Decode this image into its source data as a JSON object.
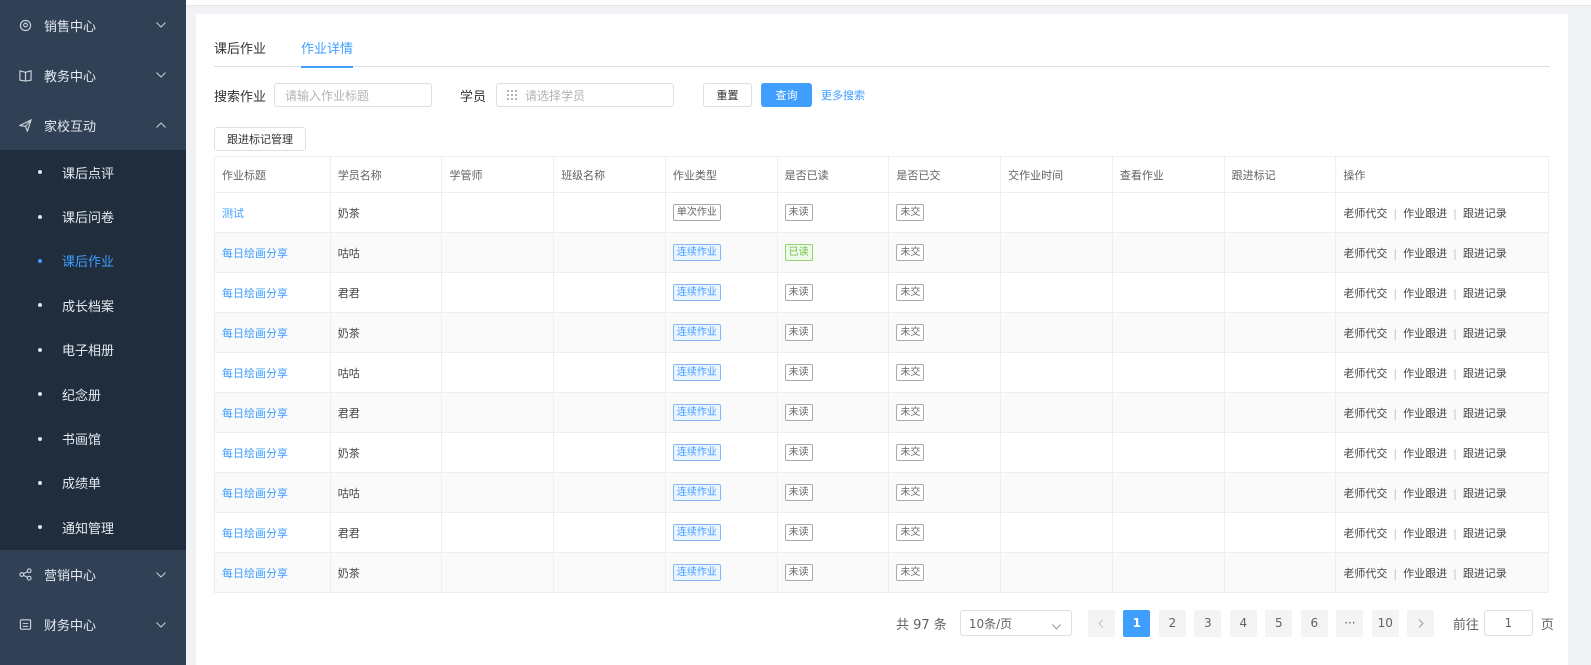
{
  "sidebar": {
    "groups_top": [
      {
        "label": "销售中心",
        "icon": "headset-icon"
      },
      {
        "label": "教务中心",
        "icon": "book-icon"
      },
      {
        "label": "家校互动",
        "icon": "paper-plane-icon"
      }
    ],
    "sub_items": [
      {
        "label": "课后点评"
      },
      {
        "label": "课后问卷"
      },
      {
        "label": "课后作业"
      },
      {
        "label": "成长档案"
      },
      {
        "label": "电子相册"
      },
      {
        "label": "纪念册"
      },
      {
        "label": "书画馆"
      },
      {
        "label": "成绩单"
      },
      {
        "label": "通知管理"
      }
    ],
    "groups_bottom": [
      {
        "label": "营销中心",
        "icon": "share-icon"
      },
      {
        "label": "财务中心",
        "icon": "wallet-icon"
      }
    ]
  },
  "tabs": [
    {
      "label": "课后作业"
    },
    {
      "label": "作业详情"
    }
  ],
  "search": {
    "homework_label": "搜索作业",
    "homework_placeholder": "请输入作业标题",
    "student_label": "学员",
    "student_placeholder": "请选择学员",
    "reset_label": "重置",
    "query_label": "查询",
    "more_label": "更多搜索"
  },
  "manage_button": "跟进标记管理",
  "table": {
    "headers": [
      "作业标题",
      "学员名称",
      "学管师",
      "班级名称",
      "作业类型",
      "是否已读",
      "是否已交",
      "交作业时间",
      "查看作业",
      "跟进标记",
      "操作"
    ],
    "ops": [
      "老师代交",
      "作业跟进",
      "跟进记录"
    ],
    "rows": [
      {
        "title": "测试",
        "student": "奶茶",
        "type": "单次作业",
        "read": "未读",
        "submitted": "未交"
      },
      {
        "title": "每日绘画分享",
        "student": "咕咕",
        "type": "连续作业",
        "read": "已读",
        "submitted": "未交"
      },
      {
        "title": "每日绘画分享",
        "student": "君君",
        "type": "连续作业",
        "read": "未读",
        "submitted": "未交"
      },
      {
        "title": "每日绘画分享",
        "student": "奶茶",
        "type": "连续作业",
        "read": "未读",
        "submitted": "未交"
      },
      {
        "title": "每日绘画分享",
        "student": "咕咕",
        "type": "连续作业",
        "read": "未读",
        "submitted": "未交"
      },
      {
        "title": "每日绘画分享",
        "student": "君君",
        "type": "连续作业",
        "read": "未读",
        "submitted": "未交"
      },
      {
        "title": "每日绘画分享",
        "student": "奶茶",
        "type": "连续作业",
        "read": "未读",
        "submitted": "未交"
      },
      {
        "title": "每日绘画分享",
        "student": "咕咕",
        "type": "连续作业",
        "read": "未读",
        "submitted": "未交"
      },
      {
        "title": "每日绘画分享",
        "student": "君君",
        "type": "连续作业",
        "read": "未读",
        "submitted": "未交"
      },
      {
        "title": "每日绘画分享",
        "student": "奶茶",
        "type": "连续作业",
        "read": "未读",
        "submitted": "未交"
      }
    ]
  },
  "pagination": {
    "total": "共 97 条",
    "page_size": "10条/页",
    "pages": [
      "1",
      "2",
      "3",
      "4",
      "5",
      "6",
      "···",
      "10"
    ],
    "current": "1",
    "goto_label": "前往",
    "goto_value": "1",
    "page_unit": "页"
  },
  "colors": {
    "accent": "#409eff",
    "sidebar_bg": "#304156",
    "submenu_bg": "#1f2d3d"
  }
}
